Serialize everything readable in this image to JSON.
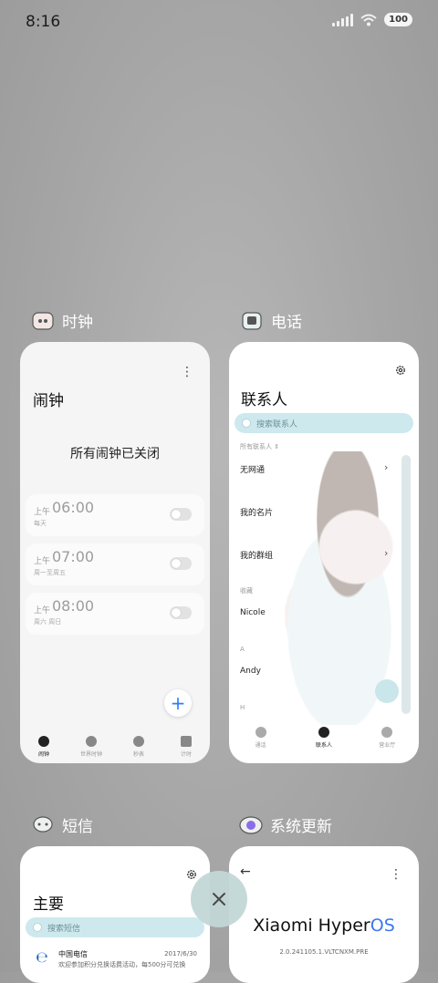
{
  "status_bar": {
    "time": "8:16",
    "battery": "100"
  },
  "apps": {
    "clock": {
      "name": "时钟",
      "title": "闹钟",
      "empty_text": "所有闹钟已关闭",
      "alarms": [
        {
          "ampm": "上午",
          "time": "06:00",
          "days": "每天",
          "enabled": false
        },
        {
          "ampm": "上午",
          "time": "07:00",
          "days": "周一至周五",
          "enabled": false
        },
        {
          "ampm": "上午",
          "time": "08:00",
          "days": "周六 周日",
          "enabled": false
        }
      ],
      "fab": "+",
      "nav": [
        "闹钟",
        "世界时钟",
        "秒表",
        "计时"
      ]
    },
    "phone": {
      "name": "电话",
      "title": "联系人",
      "search_placeholder": "搜索联系人",
      "filter": "所有联系人 ⇕",
      "rows": [
        "无网通",
        "我的名片",
        "我的群组"
      ],
      "section_favorites": "收藏",
      "favorites": [
        "Nicole"
      ],
      "section_a": "A",
      "contacts_a": [
        "Andy"
      ],
      "section_h": "H",
      "nav": [
        "通话",
        "联系人",
        "营业厅"
      ]
    },
    "sms": {
      "name": "短信",
      "title": "主要",
      "search_placeholder": "搜索短信",
      "messages": [
        {
          "sender": "中国电信",
          "date": "2017/6/30",
          "preview": "欢迎参加积分兑换话费活动，每500分可兑换"
        }
      ]
    },
    "update": {
      "name": "系统更新",
      "brand_prefix": "Xiaomi Hyper",
      "brand_suffix": "OS",
      "version": "2.0.241105.1.VLTCNXM.PRE",
      "back": "←"
    }
  },
  "close_label": "×"
}
